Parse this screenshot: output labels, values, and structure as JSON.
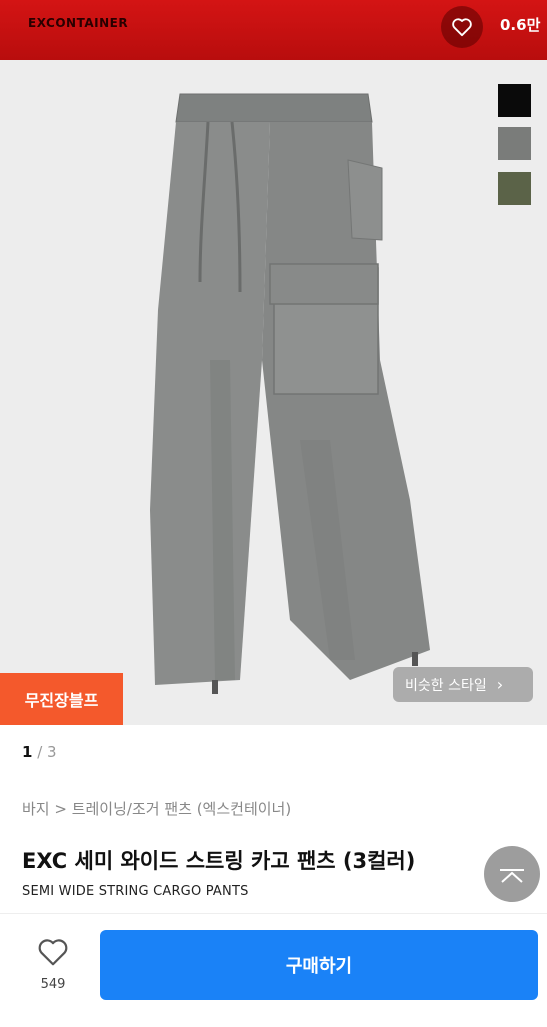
{
  "header": {
    "brand": "EXCONTAINER",
    "like_count": "0.6만",
    "icon": "heart-icon"
  },
  "image": {
    "swatches": [
      "#0a0a0a",
      "#7a7c7a",
      "#5b6348"
    ],
    "badge": "무진장블프",
    "similar_button": "비슷한 스타일",
    "pager_current": "1",
    "pager_total": "3"
  },
  "product": {
    "breadcrumb": "바지 > 트레이닝/조거 팬츠 (엑스컨테이너)",
    "title": "EXC 세미 와이드 스트링 카고 팬츠 (3컬러)",
    "subtitle": "SEMI WIDE STRING CARGO PANTS"
  },
  "bottom": {
    "wish_count": "549",
    "buy_label": "구매하기"
  }
}
